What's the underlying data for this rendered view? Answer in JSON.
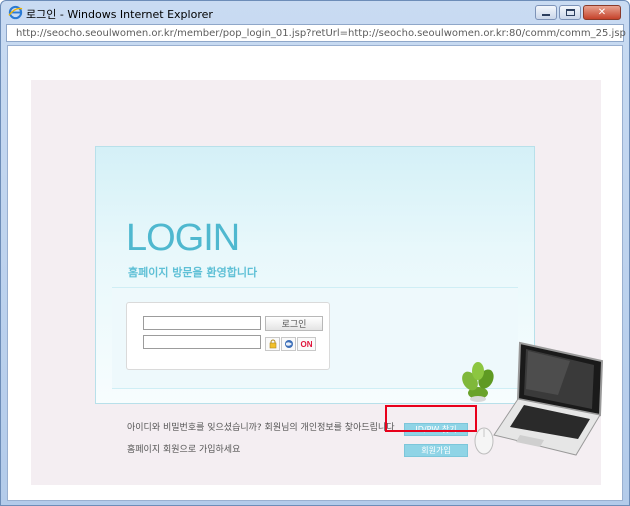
{
  "window": {
    "title": "로그인 - Windows Internet Explorer",
    "address": "http://seocho.seoulwomen.or.kr/member/pop_login_01.jsp?retUrl=http://seocho.seoulwomen.or.kr:80/comm/comm_25.jsp"
  },
  "login": {
    "heading": "LOGIN",
    "subheading": "홈페이지 방문을 환영합니다",
    "login_button": "로그인",
    "on_label": "ON",
    "id_value": "",
    "pw_value": ""
  },
  "help": {
    "forgot_text": "아이디와 비밀번호를 잊으셨습니까? 회원님의 개인정보를 찾아드립니다",
    "forgot_button": "ID/PW 찾기",
    "join_text": "홈페이지 회원으로 가입하세요",
    "join_button": "회원가입"
  },
  "colors": {
    "accent": "#4fb8cf",
    "button": "#8fd4e6",
    "highlight": "#e8001b"
  }
}
